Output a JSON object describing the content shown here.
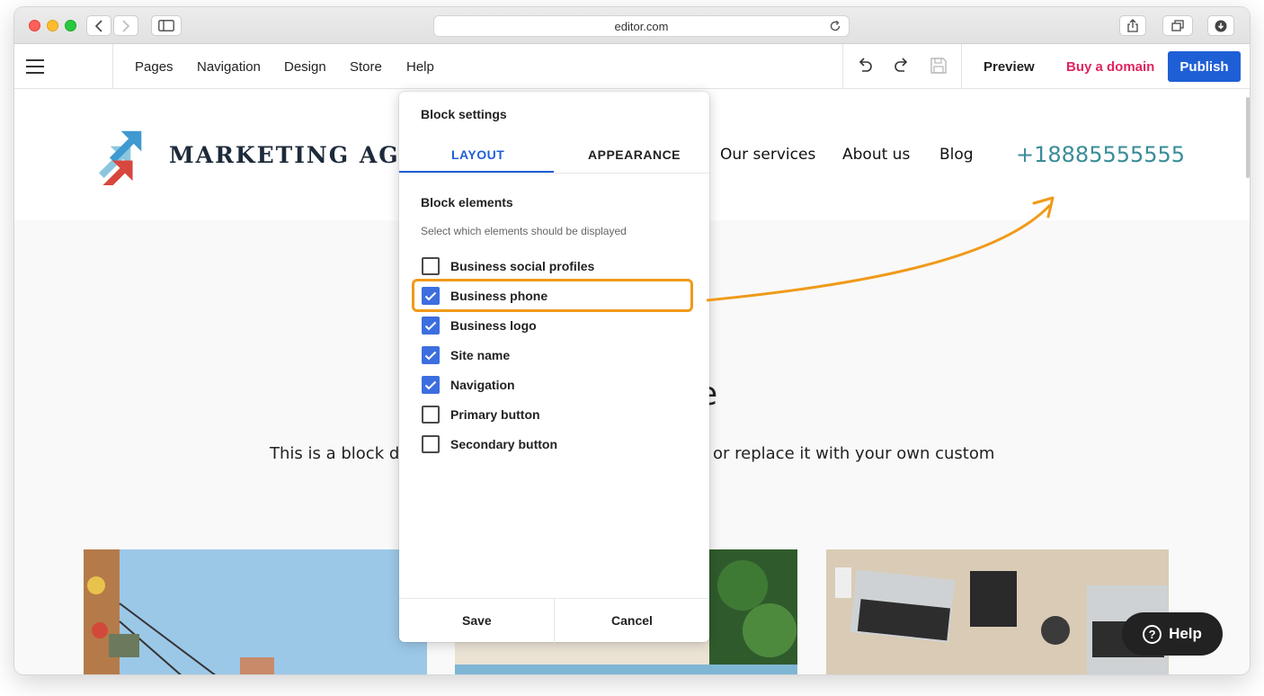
{
  "browser": {
    "url": "editor.com"
  },
  "editor": {
    "menu": [
      "Pages",
      "Navigation",
      "Design",
      "Store",
      "Help"
    ],
    "preview_label": "Preview",
    "buy_domain_label": "Buy a domain",
    "publish_label": "Publish"
  },
  "site": {
    "name": "MARKETING AGE",
    "nav": [
      "Our services",
      "About us",
      "Blog"
    ],
    "phone": "+18885555555",
    "hero_title_visible": "e",
    "hero_text_left": "This is a block de",
    "hero_text_right": "or replace it with your own custom"
  },
  "panel": {
    "title": "Block settings",
    "tabs": [
      "LAYOUT",
      "APPEARANCE"
    ],
    "active_tab": "LAYOUT",
    "section_title": "Block elements",
    "section_subtitle": "Select which elements should be displayed",
    "options": [
      {
        "label": "Business social profiles",
        "checked": false
      },
      {
        "label": "Business phone",
        "checked": true
      },
      {
        "label": "Business logo",
        "checked": true
      },
      {
        "label": "Site name",
        "checked": true
      },
      {
        "label": "Navigation",
        "checked": true
      },
      {
        "label": "Primary button",
        "checked": false
      },
      {
        "label": "Secondary button",
        "checked": false
      }
    ],
    "save_label": "Save",
    "cancel_label": "Cancel"
  },
  "help_button": {
    "label": "Help"
  },
  "colors": {
    "accent": "#1f5fd6",
    "buy_domain": "#e0245e",
    "phone": "#3a8c98",
    "highlight": "#f09a1a",
    "checkbox": "#3d6ee0"
  }
}
